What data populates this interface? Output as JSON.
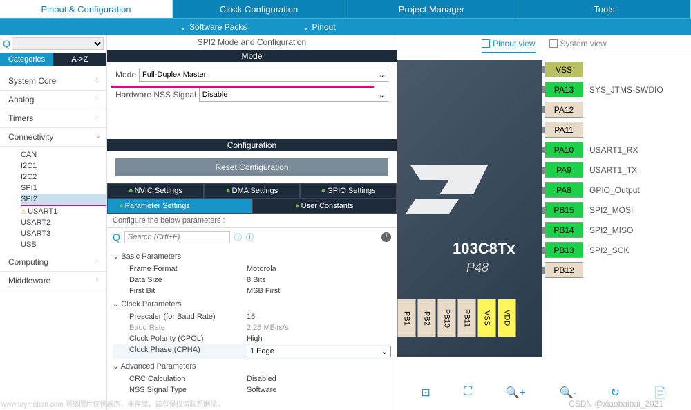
{
  "top_tabs": [
    "Pinout & Configuration",
    "Clock Configuration",
    "Project Manager",
    "Tools"
  ],
  "sub_bar": {
    "software_packs": "Software Packs",
    "pinout": "Pinout"
  },
  "left": {
    "q": "Q",
    "cat_tabs": [
      "Categories",
      "A->Z"
    ],
    "cats": [
      {
        "name": "System Core",
        "expanded": false
      },
      {
        "name": "Analog",
        "expanded": false
      },
      {
        "name": "Timers",
        "expanded": false
      },
      {
        "name": "Connectivity",
        "expanded": true,
        "items": [
          "CAN",
          "I2C1",
          "I2C2",
          "SPI1",
          "SPI2",
          "USART1",
          "USART2",
          "USART3",
          "USB"
        ],
        "selected": "SPI2",
        "warn": "USART1"
      },
      {
        "name": "Computing",
        "expanded": false
      },
      {
        "name": "Middleware",
        "expanded": false
      }
    ]
  },
  "middle": {
    "title": "SPI2 Mode and Configuration",
    "mode_header": "Mode",
    "mode_label": "Mode",
    "mode_value": "Full-Duplex Master",
    "nss_label": "Hardware NSS Signal",
    "nss_value": "Disable",
    "config_header": "Configuration",
    "reset": "Reset Configuration",
    "tabs": {
      "nvic": "NVIC Settings",
      "dma": "DMA Settings",
      "gpio": "GPIO Settings",
      "param": "Parameter Settings",
      "user": "User Constants"
    },
    "config_desc": "Configure the below parameters :",
    "search_placeholder": "Search (Crtl+F)",
    "groups": [
      {
        "name": "Basic Parameters",
        "params": [
          {
            "name": "Frame Format",
            "value": "Motorola"
          },
          {
            "name": "Data Size",
            "value": "8 Bits"
          },
          {
            "name": "First Bit",
            "value": "MSB First"
          }
        ]
      },
      {
        "name": "Clock Parameters",
        "params": [
          {
            "name": "Prescaler (for Baud Rate)",
            "value": "16"
          },
          {
            "name": "Baud Rate",
            "value": "2.25 MBits/s",
            "gray": true
          },
          {
            "name": "Clock Polarity (CPOL)",
            "value": "High"
          },
          {
            "name": "Clock Phase (CPHA)",
            "value": "1 Edge",
            "selected": true
          }
        ]
      },
      {
        "name": "Advanced Parameters",
        "params": [
          {
            "name": "CRC Calculation",
            "value": "Disabled"
          },
          {
            "name": "NSS Signal Type",
            "value": "Software"
          }
        ]
      }
    ]
  },
  "right": {
    "pinout_view": "Pinout view",
    "system_view": "System view",
    "chip_part": "103C8Tx",
    "chip_pkg": "P48",
    "pins_right": [
      {
        "name": "VSS",
        "color": "khaki",
        "label": ""
      },
      {
        "name": "PA13",
        "color": "green",
        "label": "SYS_JTMS-SWDIO"
      },
      {
        "name": "PA12",
        "color": "gray",
        "label": ""
      },
      {
        "name": "PA11",
        "color": "gray",
        "label": ""
      },
      {
        "name": "PA10",
        "color": "green",
        "label": "USART1_RX"
      },
      {
        "name": "PA9",
        "color": "green",
        "label": "USART1_TX"
      },
      {
        "name": "PA8",
        "color": "green",
        "label": "GPIO_Output"
      },
      {
        "name": "PB15",
        "color": "green",
        "label": "SPI2_MOSI"
      },
      {
        "name": "PB14",
        "color": "green",
        "label": "SPI2_MISO"
      },
      {
        "name": "PB13",
        "color": "green",
        "label": "SPI2_SCK"
      },
      {
        "name": "PB12",
        "color": "gray",
        "label": ""
      }
    ],
    "pins_bottom": [
      {
        "name": "PB1",
        "color": "gray"
      },
      {
        "name": "PB2",
        "color": "gray"
      },
      {
        "name": "PB10",
        "color": "gray"
      },
      {
        "name": "PB11",
        "color": "gray"
      },
      {
        "name": "VSS",
        "color": "khaki"
      },
      {
        "name": "VDD",
        "color": "khaki"
      }
    ]
  },
  "watermark1": "www.toymoban.com 网络图片仅供展示，非存储，如有侵权请联系删除。",
  "watermark2": "CSDN @xiaobaibai_2021"
}
